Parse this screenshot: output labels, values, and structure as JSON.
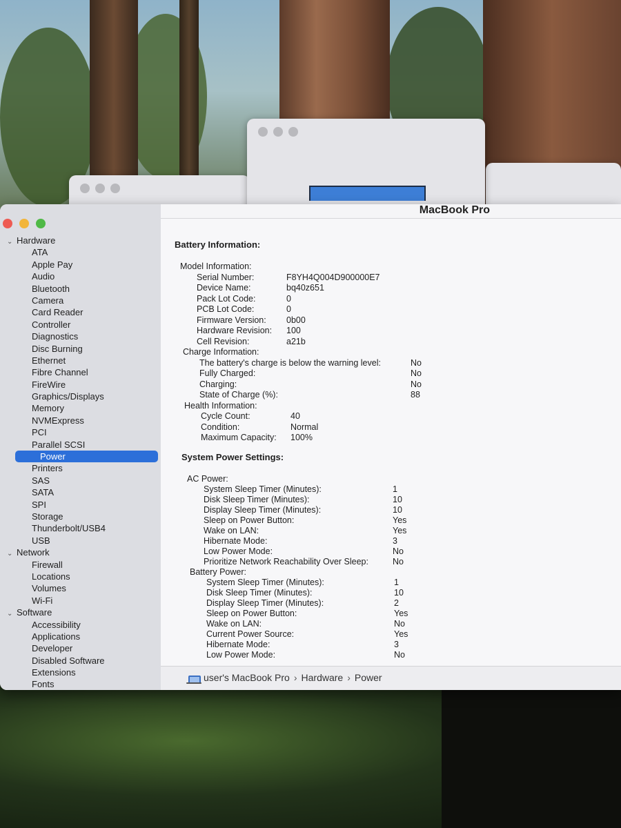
{
  "window": {
    "title": "MacBook Pro"
  },
  "sidebar": {
    "groups": [
      {
        "label": "Hardware",
        "items": [
          "ATA",
          "Apple Pay",
          "Audio",
          "Bluetooth",
          "Camera",
          "Card Reader",
          "Controller",
          "Diagnostics",
          "Disc Burning",
          "Ethernet",
          "Fibre Channel",
          "FireWire",
          "Graphics/Displays",
          "Memory",
          "NVMExpress",
          "PCI",
          "Parallel SCSI",
          "Power",
          "Printers",
          "SAS",
          "SATA",
          "SPI",
          "Storage",
          "Thunderbolt/USB4",
          "USB"
        ]
      },
      {
        "label": "Network",
        "items": [
          "Firewall",
          "Locations",
          "Volumes",
          "Wi-Fi"
        ]
      },
      {
        "label": "Software",
        "items": [
          "Accessibility",
          "Applications",
          "Developer",
          "Disabled Software",
          "Extensions",
          "Fonts"
        ]
      }
    ],
    "selected": "Power"
  },
  "battery": {
    "heading": "Battery Information:",
    "model_heading": "Model Information:",
    "model": [
      {
        "k": "Serial Number:",
        "v": "F8YH4Q004D900000E7"
      },
      {
        "k": "Device Name:",
        "v": "bq40z651"
      },
      {
        "k": "Pack Lot Code:",
        "v": "0"
      },
      {
        "k": "PCB Lot Code:",
        "v": "0"
      },
      {
        "k": "Firmware Version:",
        "v": "0b00"
      },
      {
        "k": "Hardware Revision:",
        "v": "100"
      },
      {
        "k": "Cell Revision:",
        "v": "a21b"
      }
    ],
    "charge_heading": "Charge Information:",
    "charge": [
      {
        "k": "The battery's charge is below the warning level:",
        "v": "No"
      },
      {
        "k": "Fully Charged:",
        "v": "No"
      },
      {
        "k": "Charging:",
        "v": "No"
      },
      {
        "k": "State of Charge (%):",
        "v": "88"
      }
    ],
    "health_heading": "Health Information:",
    "health": [
      {
        "k": "Cycle Count:",
        "v": "40"
      },
      {
        "k": "Condition:",
        "v": "Normal"
      },
      {
        "k": "Maximum Capacity:",
        "v": "100%"
      }
    ]
  },
  "power": {
    "heading": "System Power Settings:",
    "ac_heading": "AC Power:",
    "ac": [
      {
        "k": "System Sleep Timer (Minutes):",
        "v": "1"
      },
      {
        "k": "Disk Sleep Timer (Minutes):",
        "v": "10"
      },
      {
        "k": "Display Sleep Timer (Minutes):",
        "v": "10"
      },
      {
        "k": "Sleep on Power Button:",
        "v": "Yes"
      },
      {
        "k": "Wake on LAN:",
        "v": "Yes"
      },
      {
        "k": "Hibernate Mode:",
        "v": "3"
      },
      {
        "k": "Low Power Mode:",
        "v": "No"
      },
      {
        "k": "Prioritize Network Reachability Over Sleep:",
        "v": "No"
      }
    ],
    "battery_heading": "Battery Power:",
    "battery": [
      {
        "k": "System Sleep Timer (Minutes):",
        "v": "1"
      },
      {
        "k": "Disk Sleep Timer (Minutes):",
        "v": "10"
      },
      {
        "k": "Display Sleep Timer (Minutes):",
        "v": "2"
      },
      {
        "k": "Sleep on Power Button:",
        "v": "Yes"
      },
      {
        "k": "Wake on LAN:",
        "v": "No"
      },
      {
        "k": "Current Power Source:",
        "v": "Yes"
      },
      {
        "k": "Hibernate Mode:",
        "v": "3"
      },
      {
        "k": "Low Power Mode:",
        "v": "No"
      }
    ]
  },
  "statusbar": {
    "crumbs": [
      "user's MacBook Pro",
      "Hardware",
      "Power"
    ],
    "icon": "laptop-icon"
  },
  "colors": {
    "selection": "#2c6fd9",
    "close": "#ee5b53",
    "minimize": "#f2b53a",
    "zoom": "#4fb946"
  }
}
